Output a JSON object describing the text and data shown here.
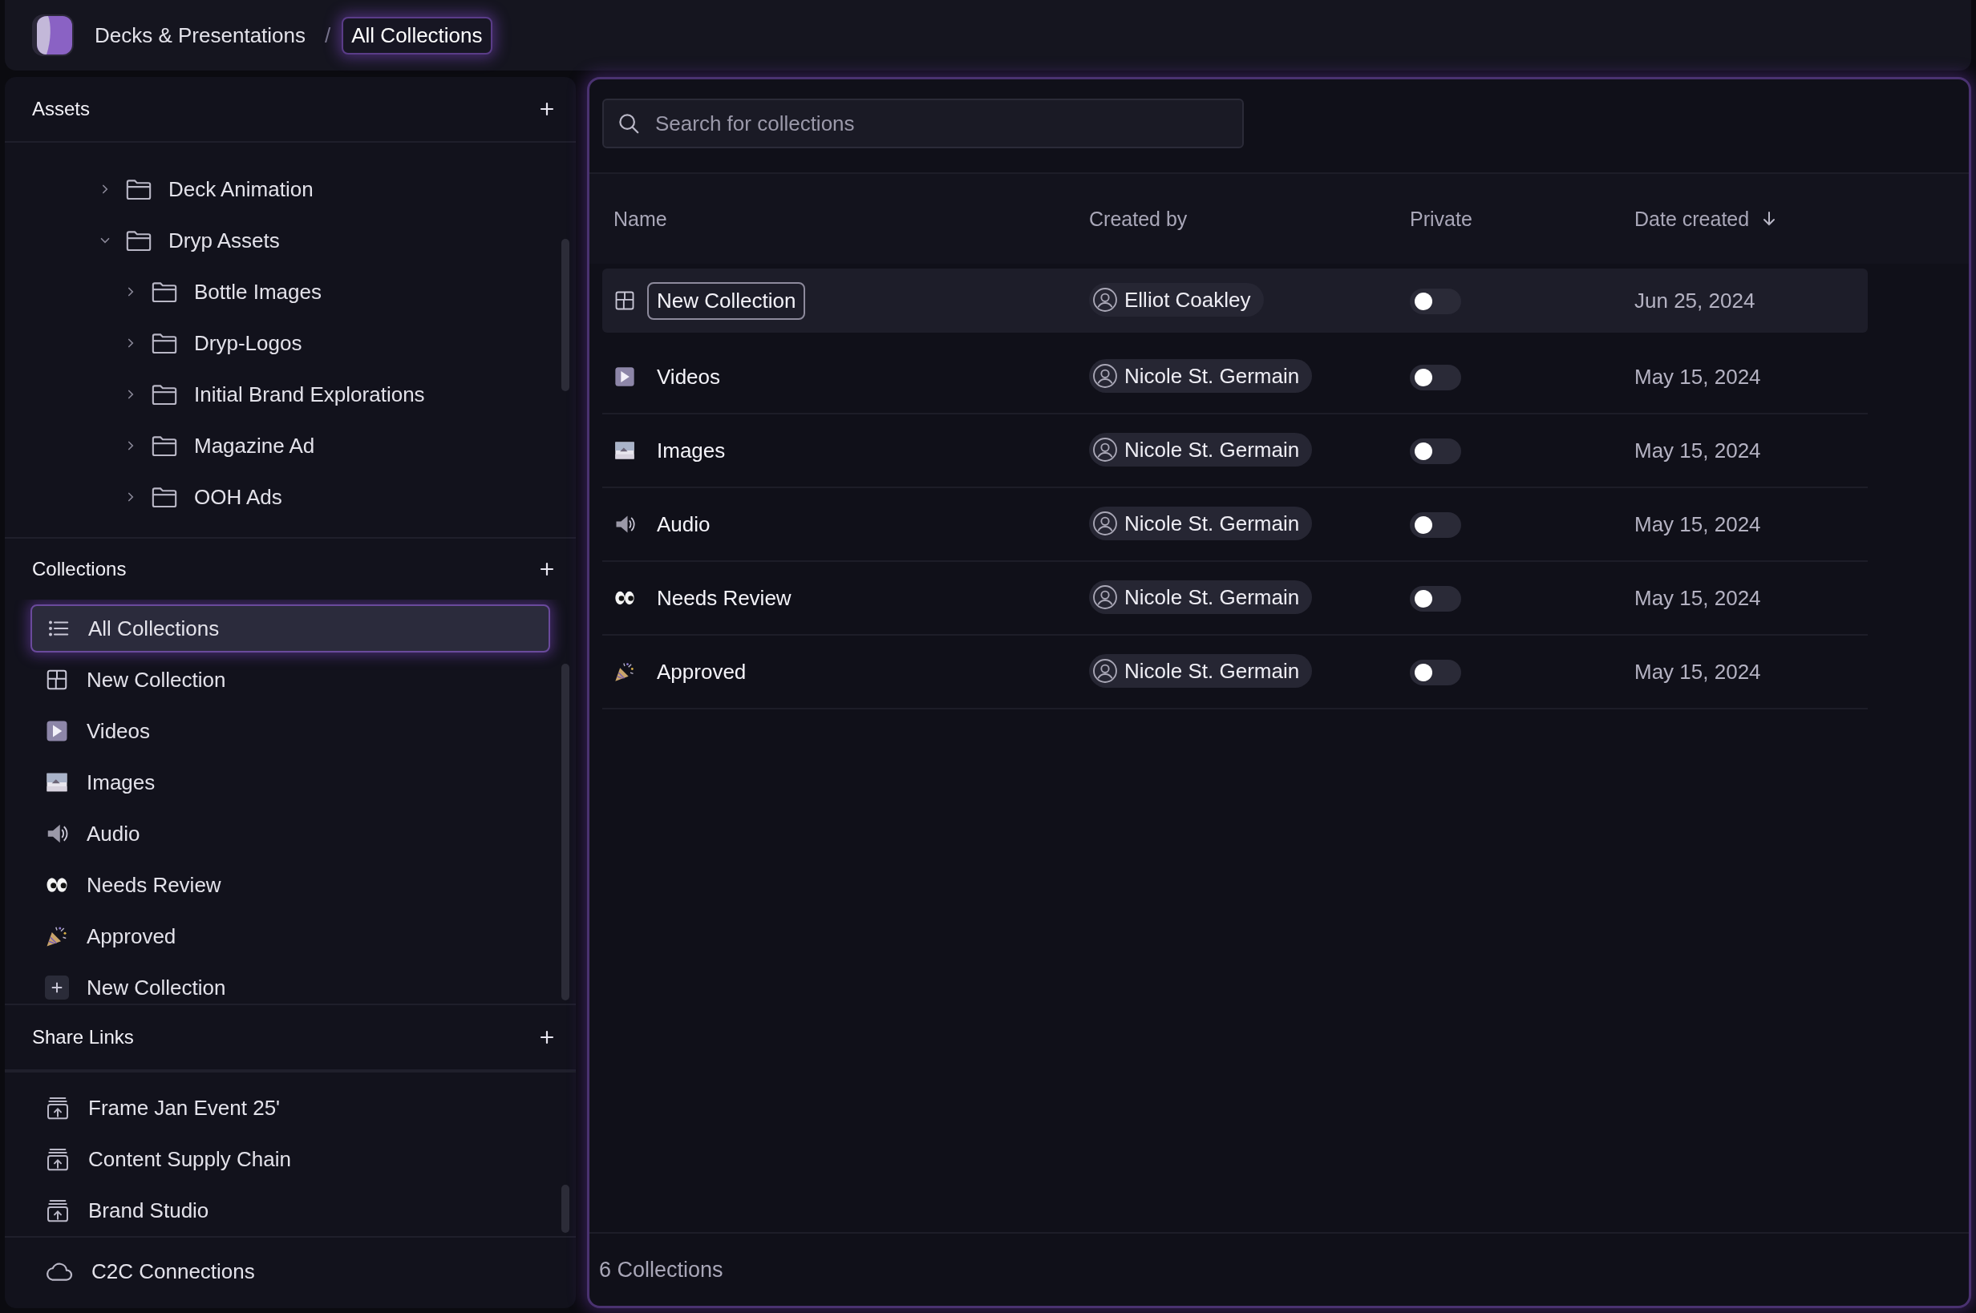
{
  "breadcrumb_separator": "/",
  "breadcrumb": [
    {
      "label": "Decks & Presentations",
      "selected": false
    },
    {
      "label": "All Collections",
      "selected": true
    }
  ],
  "sidebar": {
    "assets": {
      "title": "Assets",
      "tree": [
        {
          "label": "Deck Animation",
          "expanded": false
        },
        {
          "label": "Dryp Assets",
          "expanded": true,
          "children": [
            {
              "label": "Bottle Images",
              "expanded": false
            },
            {
              "label": "Dryp-Logos",
              "expanded": false
            },
            {
              "label": "Initial Brand Explorations",
              "expanded": false
            },
            {
              "label": "Magazine Ad",
              "expanded": false
            },
            {
              "label": "OOH Ads",
              "expanded": false
            }
          ]
        }
      ]
    },
    "collections": {
      "title": "Collections",
      "items": [
        {
          "label": "All Collections",
          "kind": "list",
          "selected": true
        },
        {
          "label": "New Collection",
          "kind": "grid",
          "selected": false
        },
        {
          "label": "Videos",
          "kind": "video",
          "selected": false
        },
        {
          "label": "Images",
          "kind": "image",
          "selected": false
        },
        {
          "label": "Audio",
          "kind": "audio",
          "selected": false
        },
        {
          "label": "Needs Review",
          "kind": "eyes",
          "selected": false
        },
        {
          "label": "Approved",
          "kind": "party",
          "selected": false
        },
        {
          "label": "New Collection",
          "kind": "add",
          "selected": false
        }
      ]
    },
    "share_links": {
      "title": "Share Links",
      "items": [
        {
          "label": "Frame Jan Event 25'"
        },
        {
          "label": "Content Supply Chain"
        },
        {
          "label": "Brand Studio"
        }
      ]
    },
    "connections": {
      "label": "C2C Connections"
    }
  },
  "main": {
    "search": {
      "placeholder": "Search for collections"
    },
    "table": {
      "columns": [
        {
          "label": "Name"
        },
        {
          "label": "Created by"
        },
        {
          "label": "Private"
        },
        {
          "label": "Date created",
          "sorted_descending": true
        }
      ],
      "rows": [
        {
          "kind": "grid",
          "name": "New Collection",
          "creator": "Elliot Coakley",
          "private": false,
          "date": "Jun 25, 2024",
          "selected": true,
          "editing": true
        },
        {
          "kind": "video",
          "name": "Videos",
          "creator": "Nicole St. Germain",
          "private": false,
          "date": "May 15, 2024",
          "selected": false,
          "editing": false
        },
        {
          "kind": "image",
          "name": "Images",
          "creator": "Nicole St. Germain",
          "private": false,
          "date": "May 15, 2024",
          "selected": false,
          "editing": false
        },
        {
          "kind": "audio",
          "name": "Audio",
          "creator": "Nicole St. Germain",
          "private": false,
          "date": "May 15, 2024",
          "selected": false,
          "editing": false
        },
        {
          "kind": "eyes",
          "name": "Needs Review",
          "creator": "Nicole St. Germain",
          "private": false,
          "date": "May 15, 2024",
          "selected": false,
          "editing": false
        },
        {
          "kind": "party",
          "name": "Approved",
          "creator": "Nicole St. Germain",
          "private": false,
          "date": "May 15, 2024",
          "selected": false,
          "editing": false
        }
      ]
    },
    "footer": "6 Collections"
  }
}
